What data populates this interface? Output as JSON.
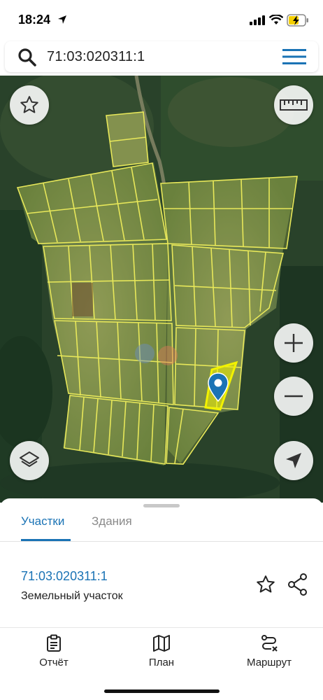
{
  "status_bar": {
    "time": "18:24"
  },
  "search": {
    "query": "71:03:020311:1"
  },
  "map": {
    "buttons": [
      "favorite",
      "ruler",
      "zoom-in",
      "zoom-out",
      "layers",
      "my-location"
    ],
    "parcel_highlight_color": "#f2f200",
    "parcel_outline_color": "#e8e85a",
    "pin_color": "#1a73b5"
  },
  "sheet": {
    "tabs": [
      {
        "label": "Участки",
        "active": true
      },
      {
        "label": "Здания",
        "active": false
      }
    ],
    "result": {
      "number": "71:03:020311:1",
      "type": "Земельный участок"
    }
  },
  "bottom_nav": [
    {
      "label": "Отчёт",
      "icon": "clipboard-icon"
    },
    {
      "label": "План",
      "icon": "map-icon"
    },
    {
      "label": "Маршрут",
      "icon": "route-icon"
    }
  ],
  "colors": {
    "accent": "#1a73b5",
    "text": "#222222",
    "muted": "#8a8a8a"
  }
}
